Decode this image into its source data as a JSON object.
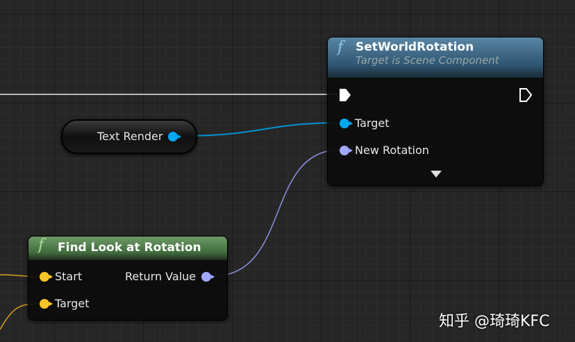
{
  "set_world_rotation": {
    "title": "SetWorldRotation",
    "subtitle": "Target is Scene Component",
    "pins": {
      "target": "Target",
      "new_rotation": "New Rotation"
    }
  },
  "text_render": {
    "label": "Text Render"
  },
  "find_look_at_rotation": {
    "title": "Find Look at Rotation",
    "pins": {
      "start": "Start",
      "target": "Target",
      "return_value": "Return Value"
    }
  },
  "watermark": "知乎 @琦琦KFC",
  "function_glyph": "f",
  "colors": {
    "object": "#00a8f0",
    "rotator": "#a0a8ff",
    "vector": "#fdc628",
    "exec": "#ffffff",
    "sets_header": "#3b6e8c",
    "find_header": "#4d7a4a"
  }
}
